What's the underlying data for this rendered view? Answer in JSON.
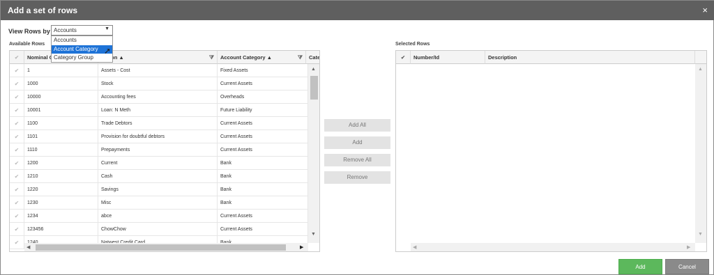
{
  "dialog": {
    "title": "Add a set of rows",
    "close_glyph": "×"
  },
  "view_rows": {
    "label": "View Rows by",
    "selected": "Accounts",
    "options": [
      "Accounts",
      "Account Category",
      "Category Group"
    ],
    "highlighted_index": 1
  },
  "available": {
    "label": "Available Rows",
    "headers": {
      "nominal": "Nominal C",
      "description": "ription ▲",
      "category": "Account Category ▲",
      "cate": "Cate"
    },
    "rows": [
      {
        "nominal": "1",
        "description": "Assets - Cost",
        "category": "Fixed Assets"
      },
      {
        "nominal": "1000",
        "description": "Stock",
        "category": "Current Assets"
      },
      {
        "nominal": "10000",
        "description": "Accounting fees",
        "category": "Overheads"
      },
      {
        "nominal": "10001",
        "description": "Loan: N Meth",
        "category": "Future Liability"
      },
      {
        "nominal": "1100",
        "description": "Trade Debtors",
        "category": "Current Assets"
      },
      {
        "nominal": "1101",
        "description": "Provision for doubtful debtors",
        "category": "Current Assets"
      },
      {
        "nominal": "1110",
        "description": "Prepayments",
        "category": "Current Assets"
      },
      {
        "nominal": "1200",
        "description": "Current",
        "category": "Bank"
      },
      {
        "nominal": "1210",
        "description": "Cash",
        "category": "Bank"
      },
      {
        "nominal": "1220",
        "description": "Savings",
        "category": "Bank"
      },
      {
        "nominal": "1230",
        "description": "Misc",
        "category": "Bank"
      },
      {
        "nominal": "1234",
        "description": "abce",
        "category": "Current Assets"
      },
      {
        "nominal": "123456",
        "description": "ChowChow",
        "category": "Current Assets"
      },
      {
        "nominal": "1240",
        "description": "Natwest Credit Card",
        "category": "Bank"
      }
    ]
  },
  "buttons": {
    "add_all": "Add All",
    "add": "Add",
    "remove_all": "Remove All",
    "remove": "Remove",
    "ok": "Add",
    "cancel": "Cancel"
  },
  "selected": {
    "label": "Selected Rows",
    "headers": {
      "number": "Number/Id",
      "description": "Description"
    }
  },
  "icons": {
    "check": "✔",
    "filter": "⧩",
    "up": "▲",
    "down": "▼",
    "left": "◀",
    "right": "▶",
    "caret": "▼",
    "cursor": "➚"
  }
}
